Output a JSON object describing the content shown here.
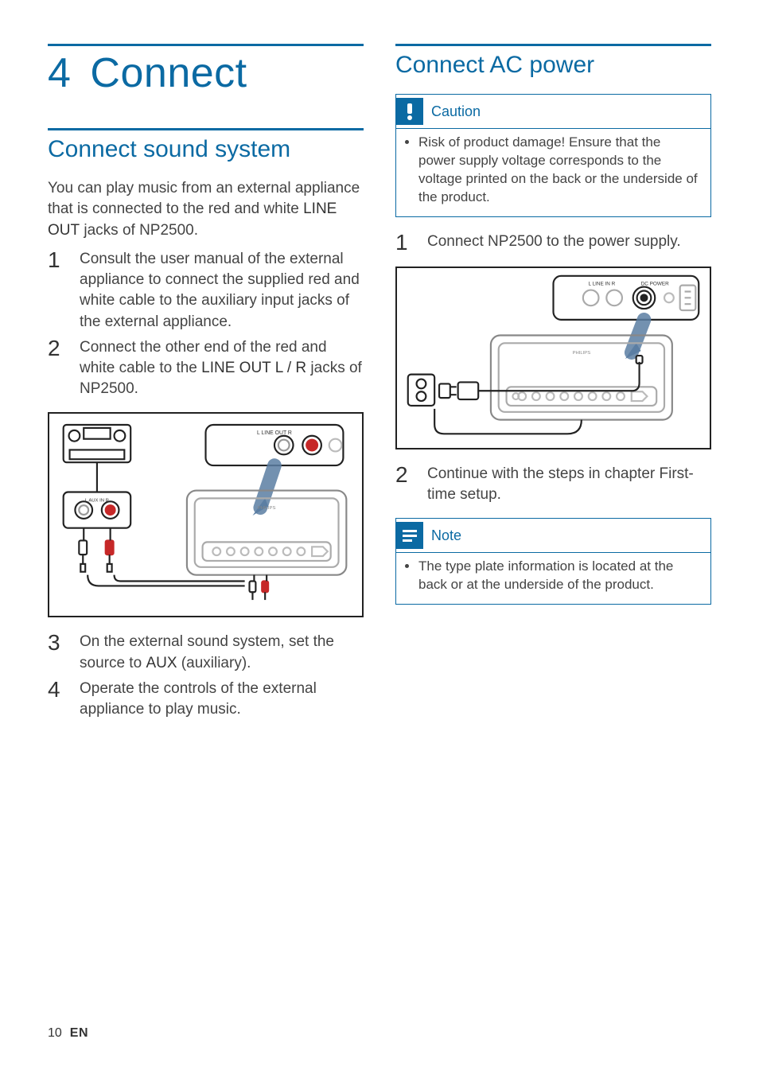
{
  "chapter": {
    "number": "4",
    "title": "Connect"
  },
  "left": {
    "section_title": "Connect sound system",
    "intro_parts": {
      "a": "You can play music from an external appliance that is connected to the red and white ",
      "b": "LINE OUT",
      "c": " jacks of NP2500."
    },
    "step1": "Consult the user manual of the external appliance to connect the supplied red and white cable to the auxiliary input jacks of the external appliance.",
    "step2": {
      "a": "Connect the other end of the red and white cable to the ",
      "b": "LINE OUT L / R",
      "c": " jacks of NP2500."
    },
    "step3": {
      "a": "On the external sound system, set the source to ",
      "b": "AUX",
      "c": " (auxiliary)."
    },
    "step4": "Operate the controls of the external appliance to play music."
  },
  "right": {
    "section_title": "Connect AC power",
    "caution_label": "Caution",
    "caution_text": "Risk of product damage! Ensure that the power supply voltage corresponds to the voltage printed on the back or the underside of the product.",
    "step1": "Connect NP2500 to the power supply.",
    "step2": "Continue with the steps in chapter First-time setup.",
    "note_label": "Note",
    "note_text": "The type plate information is located at the back or at the underside of the product."
  },
  "diagram_labels": {
    "line_out": "L   LINE OUT   R",
    "aux_in": "L   AUX IN   R",
    "line_in": "L   LINE IN   R",
    "dc_power": "DC POWER",
    "brand": "PHILIPS"
  },
  "footer": {
    "page": "10",
    "lang": "EN"
  },
  "step_numbers": {
    "one": "1",
    "two": "2",
    "three": "3",
    "four": "4"
  }
}
